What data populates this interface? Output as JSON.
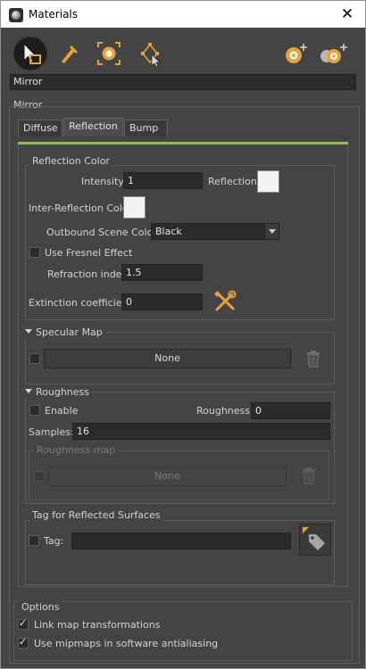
{
  "window": {
    "title": "Materials",
    "close_label": "✕"
  },
  "material": {
    "name": "Mirror"
  },
  "group_label": "Mirror",
  "tabs": [
    {
      "label": "Diffuse"
    },
    {
      "label": "Reflection"
    },
    {
      "label": "Bump"
    }
  ],
  "reflection_color": {
    "title": "Reflection Color",
    "intensity_label": "Intensity:",
    "intensity_value": "1",
    "reflection_label": "Reflection:",
    "interreflection_label": "Inter-Reflection Color:",
    "outbound_label": "Outbound Scene Color:",
    "outbound_value": "Black",
    "fresnel_label": "Use Fresnel Effect",
    "refraction_label": "Refraction index:",
    "refraction_value": "1.5",
    "extinction_label": "Extinction coefficient:",
    "extinction_value": "0"
  },
  "specular_map": {
    "title": "Specular Map",
    "button_label": "None"
  },
  "roughness": {
    "title": "Roughness",
    "enable_label": "Enable",
    "roughness_label": "Roughness:",
    "roughness_value": "0",
    "samples_label": "Samples:",
    "samples_value": "16",
    "map_title": "Roughness map",
    "map_button_label": "None"
  },
  "tag": {
    "title": "Tag for Reflected Surfaces",
    "label": "Tag:",
    "value": ""
  },
  "options": {
    "title": "Options",
    "link_map_label": "Link map transformations",
    "mipmaps_label": "Use mipmaps in software antialiasing"
  },
  "colors": {
    "accent": "#8bc34a",
    "tool_orange": "#e8a23a",
    "panel_bg": "#444444"
  }
}
